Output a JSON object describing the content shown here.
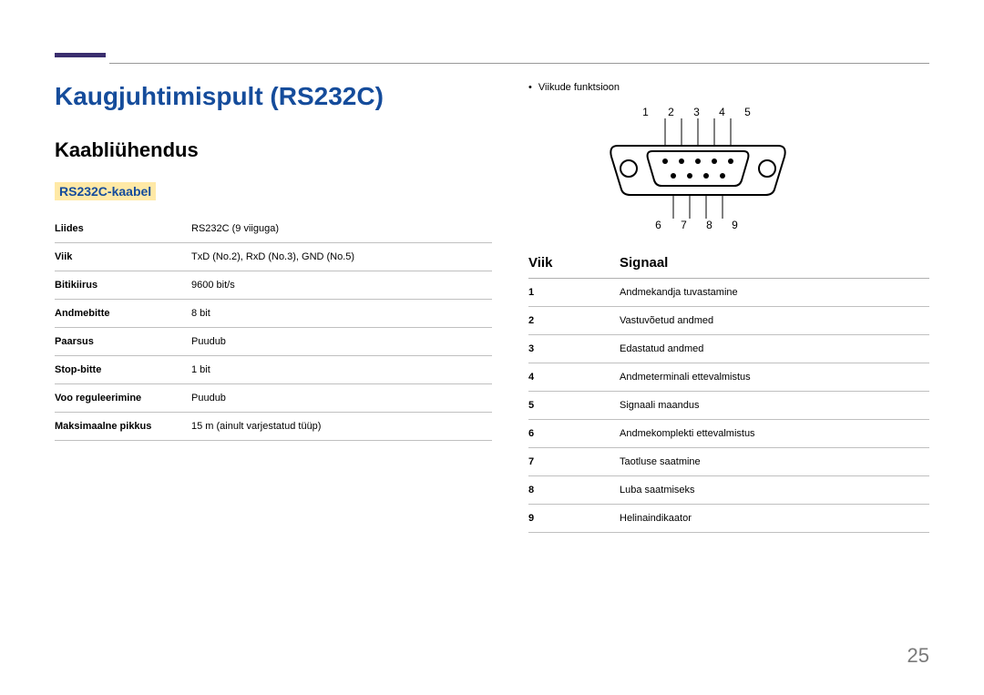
{
  "headings": {
    "h1": "Kaugjuhtimispult (RS232C)",
    "h2": "Kaabliühendus",
    "h3": "RS232C-kaabel"
  },
  "specs": [
    {
      "label": "Liides",
      "value": "RS232C (9 viiguga)"
    },
    {
      "label": "Viik",
      "value": "TxD (No.2), RxD (No.3), GND (No.5)"
    },
    {
      "label": "Bitikiirus",
      "value": "9600 bit/s"
    },
    {
      "label": "Andmebitte",
      "value": "8 bit"
    },
    {
      "label": "Paarsus",
      "value": "Puudub"
    },
    {
      "label": "Stop-bitte",
      "value": "1 bit"
    },
    {
      "label": "Voo reguleerimine",
      "value": "Puudub"
    },
    {
      "label": "Maksimaalne pikkus",
      "value": "15 m (ainult varjestatud tüüp)"
    }
  ],
  "right": {
    "bullet": "Viikude funktsioon",
    "pins_top": "1 2 3 4 5",
    "pins_bottom": "6 7 8 9",
    "header_pin": "Viik",
    "header_signal": "Signaal",
    "signals": [
      {
        "pin": "1",
        "name": "Andmekandja tuvastamine"
      },
      {
        "pin": "2",
        "name": "Vastuvõetud andmed"
      },
      {
        "pin": "3",
        "name": "Edastatud andmed"
      },
      {
        "pin": "4",
        "name": "Andmeterminali ettevalmistus"
      },
      {
        "pin": "5",
        "name": "Signaali maandus"
      },
      {
        "pin": "6",
        "name": "Andmekomplekti ettevalmistus"
      },
      {
        "pin": "7",
        "name": "Taotluse saatmine"
      },
      {
        "pin": "8",
        "name": "Luba saatmiseks"
      },
      {
        "pin": "9",
        "name": "Helinaindikaator"
      }
    ]
  },
  "page_number": "25"
}
